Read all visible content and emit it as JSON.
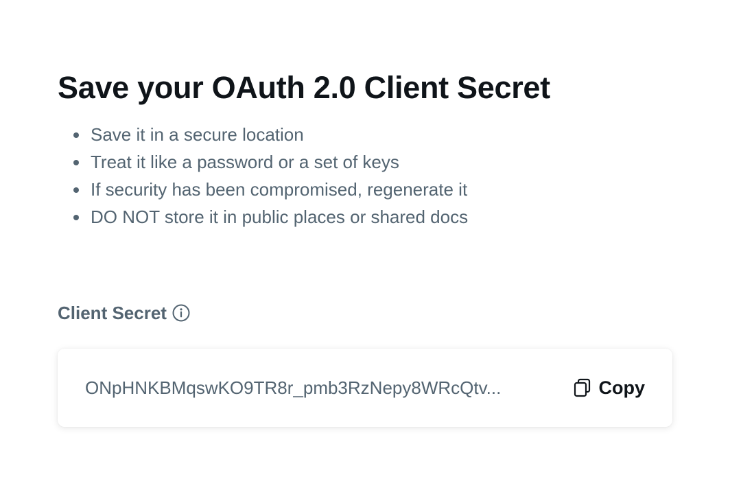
{
  "page": {
    "title": "Save your OAuth 2.0 Client Secret",
    "tips": [
      "Save it in a secure location",
      "Treat it like a password or a set of keys",
      "If security has been compromised, regenerate it",
      "DO NOT store it in public places or shared docs"
    ]
  },
  "secret": {
    "label": "Client Secret",
    "info_icon": "info-icon",
    "value": "ONpHNKBMqswKO9TR8r_pmb3RzNepy8WRcQtv...",
    "copy_label": "Copy",
    "copy_icon": "copy-icon"
  },
  "colors": {
    "text_primary": "#0f1419",
    "text_secondary": "#536471",
    "background": "#ffffff"
  }
}
